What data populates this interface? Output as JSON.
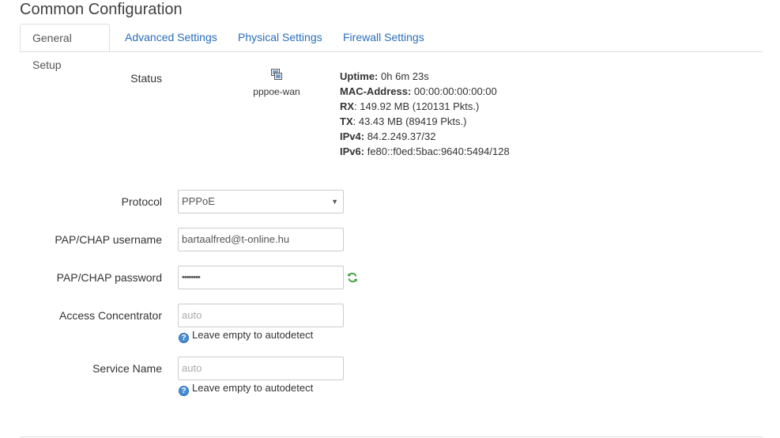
{
  "section": {
    "title": "Common Configuration"
  },
  "tabs": [
    {
      "label": "General Setup",
      "active": true
    },
    {
      "label": "Advanced Settings",
      "active": false
    },
    {
      "label": "Physical Settings",
      "active": false
    },
    {
      "label": "Firewall Settings",
      "active": false
    }
  ],
  "status": {
    "label": "Status",
    "interface_name": "pppoe-wan",
    "icon": "network-interface-icon",
    "uptime_label": "Uptime:",
    "uptime_value": "0h 6m 23s",
    "mac_label": "MAC-Address:",
    "mac_value": "00:00:00:00:00:00",
    "rx_label": "RX",
    "rx_value": ": 149.92 MB (120131 Pkts.)",
    "tx_label": "TX",
    "tx_value": ": 43.43 MB (89419 Pkts.)",
    "ipv4_label": "IPv4:",
    "ipv4_value": "84.2.249.37/32",
    "ipv6_label": "IPv6:",
    "ipv6_value": "fe80::f0ed:5bac:9640:5494/128"
  },
  "form": {
    "protocol": {
      "label": "Protocol",
      "value": "PPPoE"
    },
    "username": {
      "label": "PAP/CHAP username",
      "value": "bartaalfred@t-online.hu"
    },
    "password": {
      "label": "PAP/CHAP password",
      "value": "••••••••",
      "reveal_icon": "refresh-reveal-icon"
    },
    "access_concentrator": {
      "label": "Access Concentrator",
      "placeholder": "auto",
      "hint": "Leave empty to autodetect"
    },
    "service_name": {
      "label": "Service Name",
      "placeholder": "auto",
      "hint": "Leave empty to autodetect"
    }
  },
  "colors": {
    "link": "#2a6ebb",
    "border": "#dddddd",
    "text": "#333333",
    "info_icon": "#4a8fd4",
    "reveal_icon": "#3a9a3a"
  }
}
